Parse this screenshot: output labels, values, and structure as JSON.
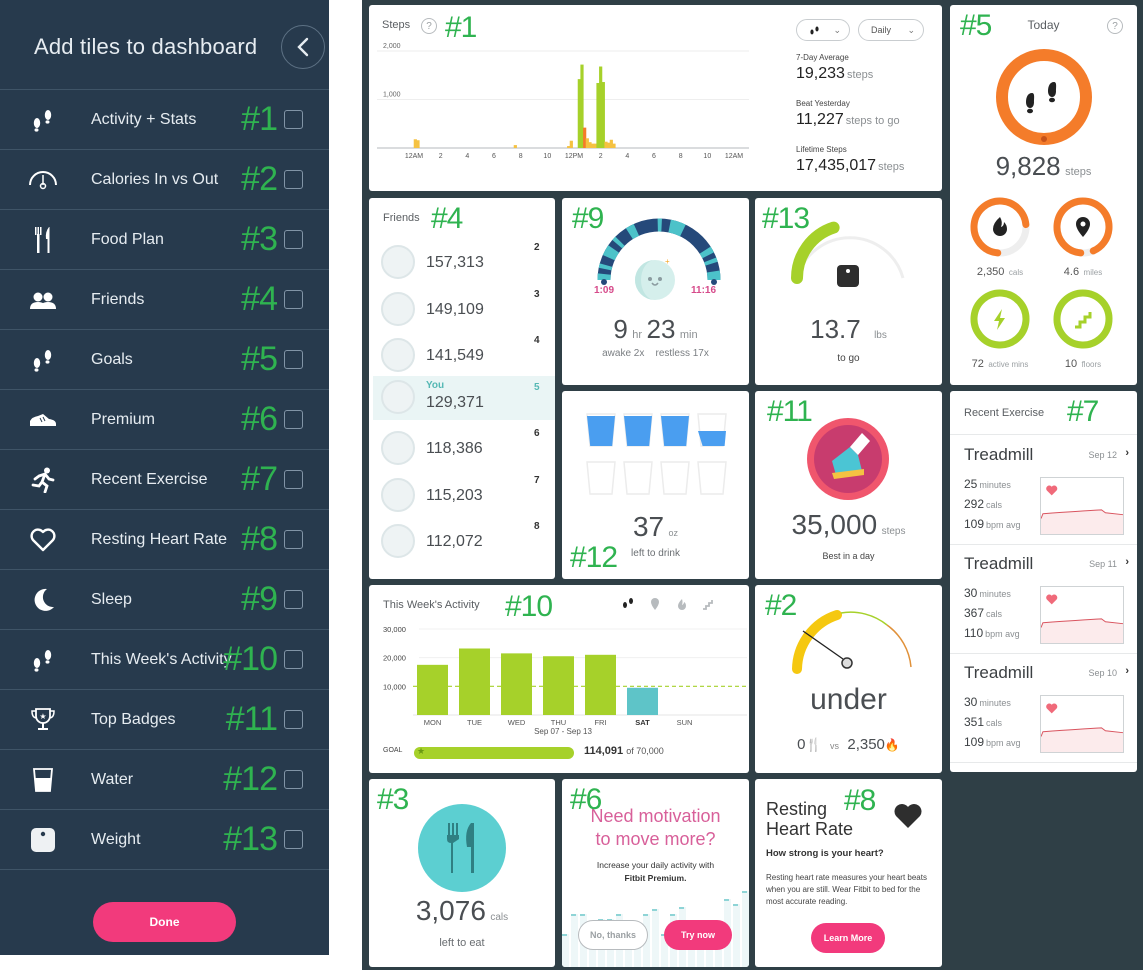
{
  "sidebar": {
    "title": "Add tiles to dashboard",
    "back_icon": "chevron-left-icon",
    "items": [
      {
        "label": "Activity + Stats",
        "icon": "footprints-icon",
        "tag": "#1",
        "checked": false
      },
      {
        "label": "Calories In vs Out",
        "icon": "gauge-icon",
        "tag": "#2",
        "checked": false
      },
      {
        "label": "Food Plan",
        "icon": "fork-knife-icon",
        "tag": "#3",
        "checked": false
      },
      {
        "label": "Friends",
        "icon": "friends-icon",
        "tag": "#4",
        "checked": false
      },
      {
        "label": "Goals",
        "icon": "footprints-icon",
        "tag": "#5",
        "checked": false
      },
      {
        "label": "Premium",
        "icon": "sneaker-icon",
        "tag": "#6",
        "checked": false
      },
      {
        "label": "Recent Exercise",
        "icon": "runner-icon",
        "tag": "#7",
        "checked": false
      },
      {
        "label": "Resting Heart Rate",
        "icon": "heart-outline-icon",
        "tag": "#8",
        "checked": false
      },
      {
        "label": "Sleep",
        "icon": "moon-icon",
        "tag": "#9",
        "checked": false
      },
      {
        "label": "This Week's Activity",
        "icon": "footprints-icon",
        "tag": "#10",
        "checked": false
      },
      {
        "label": "Top Badges",
        "icon": "trophy-icon",
        "tag": "#11",
        "checked": false
      },
      {
        "label": "Water",
        "icon": "water-glass-icon",
        "tag": "#12",
        "checked": false
      },
      {
        "label": "Weight",
        "icon": "scale-icon",
        "tag": "#13",
        "checked": false
      }
    ],
    "done_label": "Done"
  },
  "tiles": {
    "steps": {
      "tag": "#1",
      "title": "Steps",
      "help": "?",
      "metric_dropdown_icon": "footprints-icon",
      "period_dropdown": "Daily",
      "stats": [
        {
          "label": "7-Day Average",
          "value": "19,233",
          "unit": "steps"
        },
        {
          "label": "Beat Yesterday",
          "value": "11,227",
          "unit": "steps to go"
        },
        {
          "label": "Lifetime Steps",
          "value": "17,435,017",
          "unit": "steps"
        }
      ]
    },
    "today": {
      "tag": "#5",
      "title": "Today",
      "help": "?",
      "steps_value": "9,828",
      "steps_unit": "steps",
      "steps_progress": 0.98,
      "rings": [
        {
          "value": "2,350",
          "unit": "cals",
          "icon": "flame-icon",
          "progress": 0.72,
          "color": "#f47c2a"
        },
        {
          "value": "4.6",
          "unit": "miles",
          "icon": "location-pin-icon",
          "progress": 0.92,
          "color": "#f47c2a"
        },
        {
          "value": "72",
          "unit": "active mins",
          "icon": "lightning-icon",
          "progress": 1.0,
          "color": "#a6d12a"
        },
        {
          "value": "10",
          "unit": "floors",
          "icon": "stairs-icon",
          "progress": 1.0,
          "color": "#a6d12a"
        }
      ]
    },
    "friends": {
      "tag": "#4",
      "title": "Friends",
      "list": [
        {
          "rank": "2",
          "name": "",
          "steps": "157,313",
          "you": false
        },
        {
          "rank": "3",
          "name": "",
          "steps": "149,109",
          "you": false
        },
        {
          "rank": "4",
          "name": "",
          "steps": "141,549",
          "you": false
        },
        {
          "rank": "5",
          "name": "You",
          "steps": "129,371",
          "you": true
        },
        {
          "rank": "6",
          "name": "",
          "steps": "118,386",
          "you": false
        },
        {
          "rank": "7",
          "name": "",
          "steps": "115,203",
          "you": false
        },
        {
          "rank": "8",
          "name": "",
          "steps": "112,072",
          "you": false
        }
      ]
    },
    "sleep": {
      "tag": "#9",
      "start": "1:09",
      "end": "11:16",
      "hours": "9",
      "hours_unit": "hr",
      "minutes": "23",
      "minutes_unit": "min",
      "awake": "awake 2x",
      "restless": "restless 17x"
    },
    "weight": {
      "tag": "#13",
      "value": "13.7",
      "unit": "lbs",
      "caption": "to go",
      "progress": 0.4
    },
    "water": {
      "tag": "#12",
      "value": "37",
      "unit": "oz",
      "caption": "left to drink",
      "glasses_total": 8,
      "glasses_filled": 3.5
    },
    "badges": {
      "tag": "#11",
      "value": "35,000",
      "unit": "steps",
      "caption": "Best in a day"
    },
    "exercise": {
      "tag": "#7",
      "title": "Recent Exercise",
      "entries": [
        {
          "name": "Treadmill",
          "date": "Sep 12",
          "minutes": "25",
          "minutes_unit": "minutes",
          "cals": "292",
          "cals_unit": "cals",
          "bpm": "109",
          "bpm_unit": "bpm avg"
        },
        {
          "name": "Treadmill",
          "date": "Sep 11",
          "minutes": "30",
          "minutes_unit": "minutes",
          "cals": "367",
          "cals_unit": "cals",
          "bpm": "110",
          "bpm_unit": "bpm avg"
        },
        {
          "name": "Treadmill",
          "date": "Sep 10",
          "minutes": "30",
          "minutes_unit": "minutes",
          "cals": "351",
          "cals_unit": "cals",
          "bpm": "109",
          "bpm_unit": "bpm avg"
        }
      ]
    },
    "week": {
      "tag": "#10",
      "title": "This Week's Activity",
      "metric_icons": [
        "footprints-icon",
        "location-pin-icon",
        "flame-icon",
        "stairs-icon"
      ],
      "date_range": "Sep 07 - Sep 13",
      "goal_label": "GOAL",
      "goal_value": "114,091",
      "goal_of": "of 70,000",
      "goal_progress": 1.0
    },
    "calories": {
      "tag": "#2",
      "status": "under",
      "in_value": "0",
      "vs": "vs",
      "out_value": "2,350"
    },
    "food": {
      "tag": "#3",
      "value": "3,076",
      "unit": "cals",
      "caption": "left to eat"
    },
    "premium": {
      "tag": "#6",
      "headline_1": "Need motivation",
      "headline_2": "to move more?",
      "body_1": "Increase your daily activity with",
      "body_2": "Fitbit Premium",
      "no_label": "No, thanks",
      "yes_label": "Try now"
    },
    "heart": {
      "tag": "#8",
      "title_1": "Resting",
      "title_2": "Heart Rate",
      "subtitle": "How strong is your heart?",
      "body": "Resting heart rate measures your heart beats when you are still. Wear Fitbit to bed for the most accurate reading.",
      "button": "Learn More"
    }
  },
  "chart_data": [
    {
      "type": "bar",
      "title": "Steps",
      "xlabel": "",
      "ylabel": "",
      "ylim": [
        0,
        2000
      ],
      "yticks": [
        "1,000",
        "2,000"
      ],
      "xticks": [
        "12AM",
        "2",
        "4",
        "6",
        "8",
        "10",
        "12PM",
        "2",
        "4",
        "6",
        "8",
        "10",
        "12AM"
      ],
      "x_hours": [
        0.1,
        0.3,
        7.6,
        11.6,
        11.8,
        12.4,
        12.6,
        12.8,
        13.0,
        13.2,
        13.4,
        13.6,
        13.8,
        14.0,
        14.2,
        14.4,
        14.6,
        14.8,
        15.0,
        15.2,
        15.4
      ],
      "values": [
        180,
        160,
        60,
        40,
        150,
        1420,
        1720,
        420,
        200,
        120,
        90,
        90,
        1340,
        1680,
        1360,
        130,
        110,
        170,
        90,
        0,
        0
      ],
      "colors_by_level": {
        "high": "#a6d12a",
        "mid": "#f47c2a",
        "low": "#f5c242"
      }
    },
    {
      "type": "bar",
      "title": "This Week's Activity",
      "categories": [
        "MON",
        "TUE",
        "WED",
        "THU",
        "FRI",
        "SAT",
        "SUN"
      ],
      "values": [
        17500,
        23200,
        21500,
        20500,
        21000,
        9500,
        0
      ],
      "highlight": "SAT",
      "goal_line": 10000,
      "yticks": [
        "10,000",
        "20,000",
        "30,000"
      ],
      "ylim": [
        0,
        30000
      ],
      "xlabel": "Sep 07 - Sep 13",
      "colors": {
        "past": "#a6d12a",
        "today": "#5ec4c8"
      }
    }
  ]
}
